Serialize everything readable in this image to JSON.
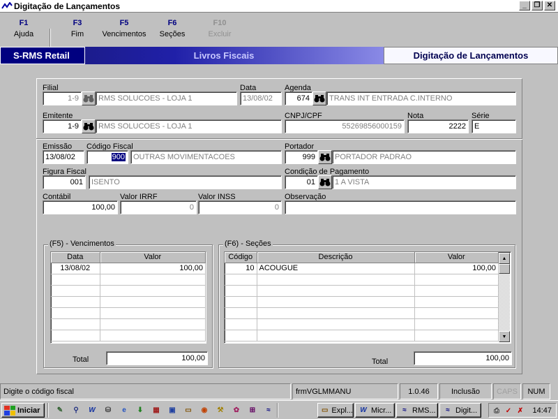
{
  "window": {
    "title": "Digitação de Lançamentos",
    "min_label": "_",
    "max_label": "❐",
    "close_label": "✕"
  },
  "function_keys": [
    {
      "key": "F1",
      "label": "Ajuda",
      "enabled": true
    },
    {
      "key": "F3",
      "label": "Fim",
      "enabled": true
    },
    {
      "key": "F5",
      "label": "Vencimentos",
      "enabled": true
    },
    {
      "key": "F6",
      "label": "Seções",
      "enabled": true
    },
    {
      "key": "F10",
      "label": "Excluir",
      "enabled": false
    }
  ],
  "banner": {
    "system": "S-RMS Retail",
    "module": "Livros Fiscais",
    "screen": "Digitação de Lançamentos"
  },
  "form": {
    "filial": {
      "label": "Filial",
      "code": "1-9",
      "name": "RMS SOLUCOES - LOJA 1"
    },
    "data": {
      "label": "Data",
      "value": "13/08/02"
    },
    "agenda": {
      "label": "Agenda",
      "code": "674",
      "name": "TRANS INT ENTRADA C.INTERNO"
    },
    "emitente": {
      "label": "Emitente",
      "code": "1-9",
      "name": "RMS SOLUCOES - LOJA 1"
    },
    "cnpj": {
      "label": "CNPJ/CPF",
      "value": "55269856000159"
    },
    "nota": {
      "label": "Nota",
      "value": "2222"
    },
    "serie": {
      "label": "Série",
      "value": "E"
    },
    "emissao": {
      "label": "Emissão",
      "value": "13/08/02"
    },
    "codigo_fiscal": {
      "label": "Código Fiscal",
      "code": "900",
      "name": "OUTRAS  MOVIMENTACOES"
    },
    "portador": {
      "label": "Portador",
      "code": "999",
      "name": "PORTADOR PADRAO"
    },
    "figura_fiscal": {
      "label": "Figura Fiscal",
      "code": "001",
      "name": "ISENTO"
    },
    "condicao_pagamento": {
      "label": "Condição de Pagamento",
      "code": "01",
      "name": "1 A VISTA"
    },
    "contabil": {
      "label": "Contábil",
      "value": "100,00"
    },
    "valor_irrf": {
      "label": "Valor IRRF",
      "value": "0"
    },
    "valor_inss": {
      "label": "Valor INSS",
      "value": "0"
    },
    "observacao": {
      "label": "Observação",
      "value": ""
    }
  },
  "vencimentos": {
    "title": "(F5) - Vencimentos",
    "columns": [
      "Data",
      "Valor"
    ],
    "rows": [
      [
        "13/08/02",
        "100,00"
      ]
    ],
    "total_label": "Total",
    "total_value": "100,00"
  },
  "secoes": {
    "title": "(F6) - Seções",
    "columns": [
      "Código",
      "Descrição",
      "Valor"
    ],
    "rows": [
      [
        "10",
        "ACOUGUE",
        "100,00"
      ]
    ],
    "total_label": "Total",
    "total_value": "100,00"
  },
  "statusbar": {
    "message": "Digite o código fiscal",
    "form_name": "frmVGLMMANU",
    "version": "1.0.46",
    "mode": "Inclusão",
    "caps": "CAPS",
    "num": "NUM"
  },
  "taskbar": {
    "start_label": "Iniciar",
    "tasks": [
      {
        "icon": "explorer-icon",
        "label": "Expl..."
      },
      {
        "icon": "word-icon",
        "label": "Micr..."
      },
      {
        "icon": "rms-icon",
        "label": "RMS..."
      },
      {
        "icon": "rms-icon",
        "label": "Digit..."
      }
    ],
    "clock": "14:47"
  },
  "colors": {
    "banner_dark": "#000080",
    "function_key": "#000080",
    "selection": "#000080"
  }
}
